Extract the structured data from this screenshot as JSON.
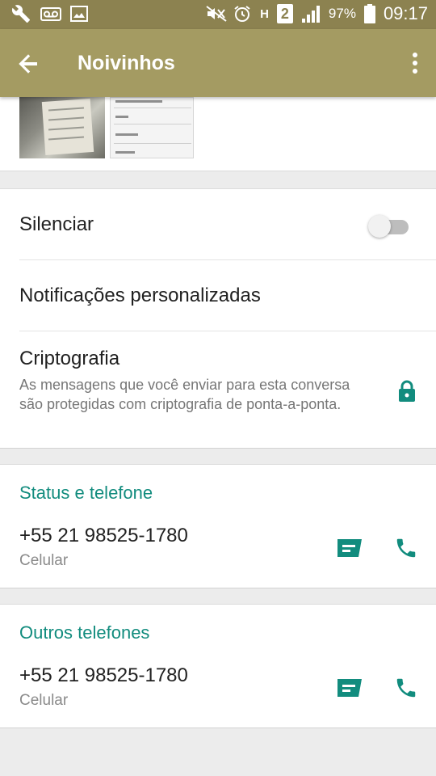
{
  "status_bar": {
    "battery": "97%",
    "time": "09:17",
    "network_label": "H",
    "sim_badge": "2",
    "icons": [
      "wrench-icon",
      "voicemail-icon",
      "image-icon",
      "mute-icon",
      "alarm-icon",
      "signal-icon",
      "battery-icon"
    ]
  },
  "app_bar": {
    "title": "Noivinhos",
    "back_icon": "arrow-back-icon",
    "menu_icon": "more-vert-icon",
    "color": "#a49b62"
  },
  "settings": {
    "mute_label": "Silenciar",
    "mute_enabled": false,
    "notifications_label": "Notificações personalizadas",
    "encryption_label": "Criptografia",
    "encryption_description": "As mensagens que você enviar para esta conversa são protegidas com criptografia de ponta-a-ponta."
  },
  "status_phone": {
    "section_title": "Status e telefone",
    "number": "+55 21 98525-1780",
    "type": "Celular"
  },
  "other_phones": {
    "section_title": "Outros telefones",
    "number": "+55 21 98525-1780",
    "type": "Celular"
  },
  "colors": {
    "accent": "#128c7e",
    "status_bar": "#8c8250"
  }
}
